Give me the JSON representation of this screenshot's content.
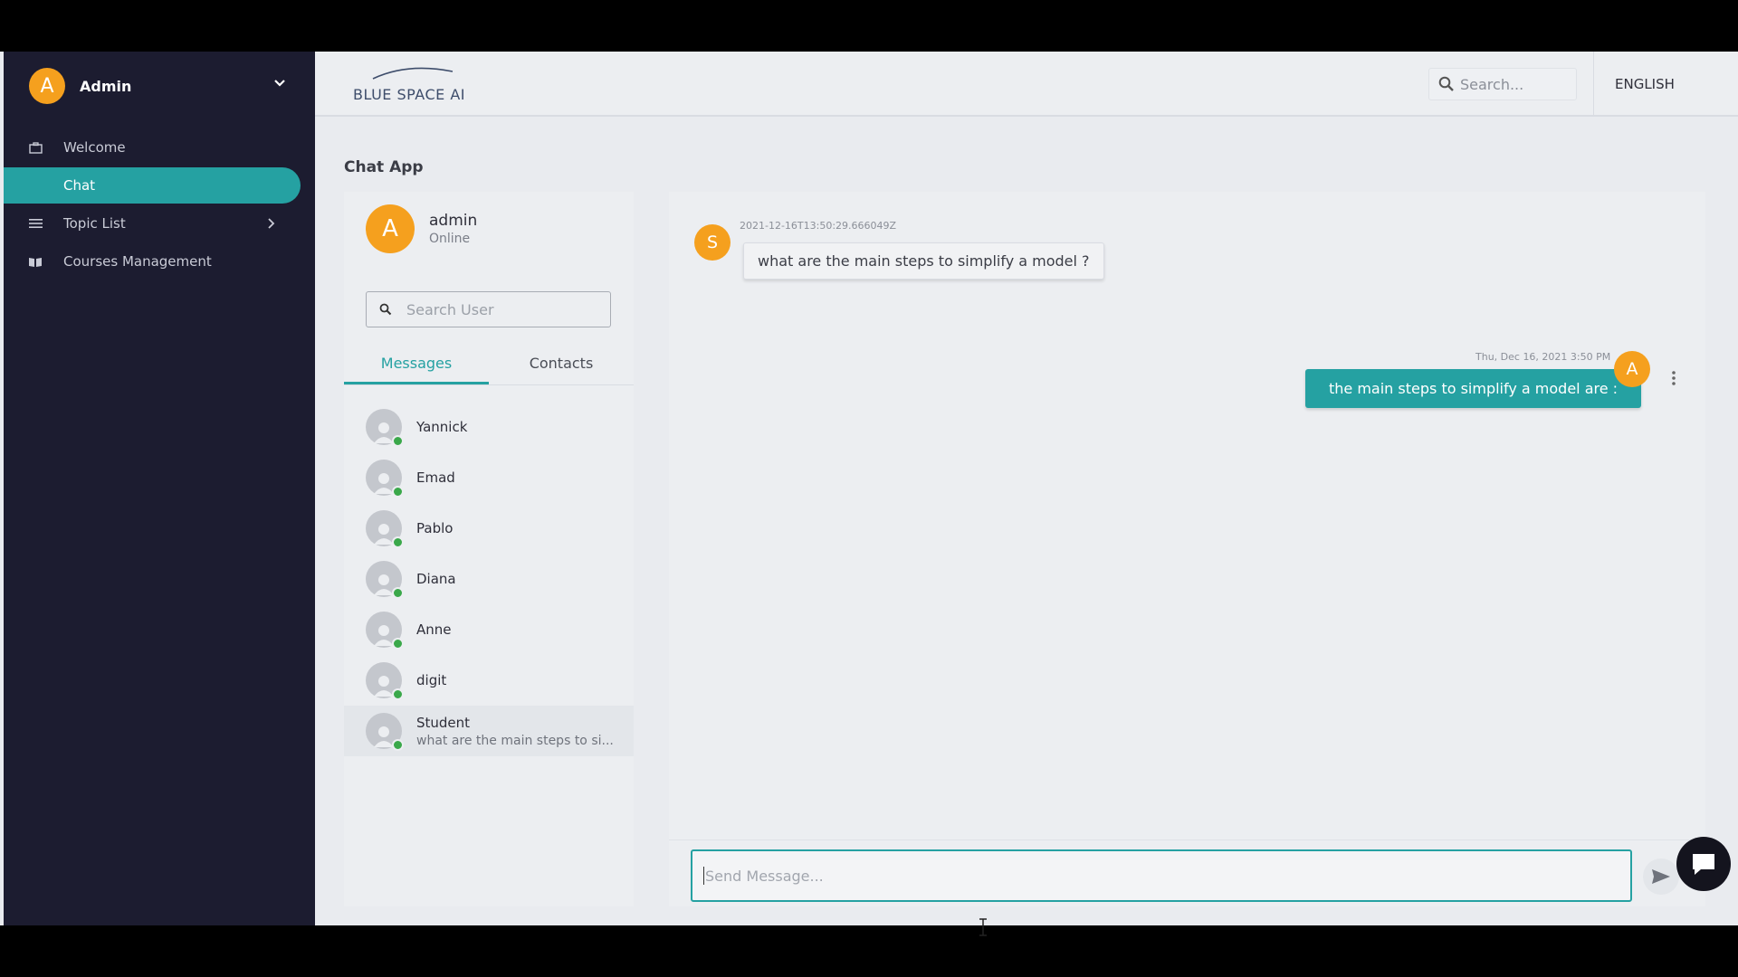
{
  "sidebar": {
    "user": {
      "initial": "A",
      "name": "Admin"
    },
    "items": [
      {
        "label": "Welcome",
        "icon": "briefcase-icon"
      },
      {
        "label": "Chat",
        "icon": "",
        "active": true
      },
      {
        "label": "Topic List",
        "icon": "list-icon"
      },
      {
        "label": "Courses Management",
        "icon": "book-icon"
      }
    ]
  },
  "topbar": {
    "logo_text": "BLUE SPACE AI",
    "search_placeholder": "Search...",
    "language": "ENGLISH"
  },
  "page": {
    "title": "Chat App"
  },
  "users_panel": {
    "me": {
      "initial": "A",
      "name": "admin",
      "status": "Online"
    },
    "search_placeholder": "Search User",
    "tabs": [
      "Messages",
      "Contacts"
    ],
    "users": [
      {
        "name": "Yannick",
        "preview": ""
      },
      {
        "name": "Emad",
        "preview": ""
      },
      {
        "name": "Pablo",
        "preview": ""
      },
      {
        "name": "Diana",
        "preview": ""
      },
      {
        "name": "Anne",
        "preview": ""
      },
      {
        "name": "digit",
        "preview": ""
      },
      {
        "name": "Student",
        "preview": "what are the main steps to si..."
      }
    ]
  },
  "chat": {
    "messages": [
      {
        "direction": "in",
        "initial": "S",
        "time": "2021-12-16T13:50:29.666049Z",
        "text": "what are the main steps to simplify a model ?"
      },
      {
        "direction": "out",
        "initial": "A",
        "time": "Thu, Dec 16, 2021 3:50 PM",
        "text": "the main steps to simplify a model are :"
      }
    ],
    "compose_placeholder": "Send Message..."
  },
  "colors": {
    "accent": "#25a1a2",
    "avatar": "#f5a01e",
    "sidebar_bg": "#1c1c30",
    "online": "#3aa84a"
  }
}
